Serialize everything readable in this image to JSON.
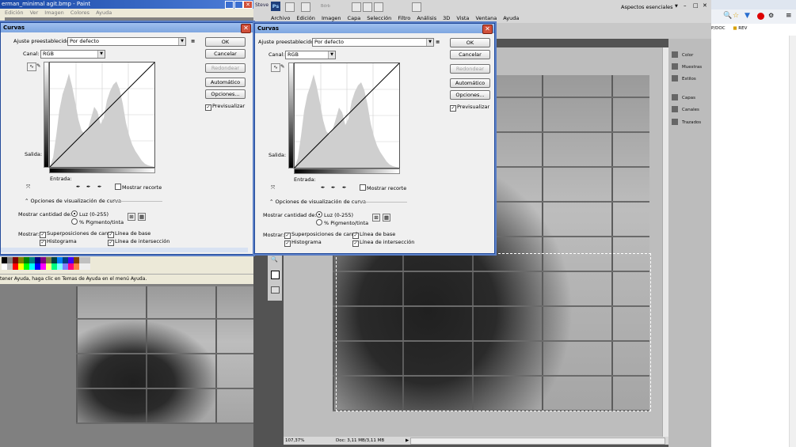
{
  "paint": {
    "title": "erman_minimal agit.bmp - Paint",
    "menu": [
      "Edición",
      "Ver",
      "Imagen",
      "Colores",
      "Ayuda"
    ],
    "status": "tener Ayuda, haga clic en Temas de Ayuda en el menú Ayuda."
  },
  "photoshop": {
    "tab": "Steve",
    "logo": "Ps",
    "tool_mini": "Bdrb",
    "menu": [
      "Archivo",
      "Edición",
      "Imagen",
      "Capa",
      "Selección",
      "Filtro",
      "Análisis",
      "3D",
      "Vista",
      "Ventana",
      "Ayuda"
    ],
    "workspace": "Aspectos esenciales",
    "zoom": "107,37%",
    "doc": "Doc: 3,11 MB/3,11 MB",
    "panels": [
      "Color",
      "Muestras",
      "Estilos",
      "Capas",
      "Canales",
      "Trazados"
    ]
  },
  "browser": {
    "bookmark1": "P/DOC",
    "bookmark2": "REV"
  },
  "curves": {
    "title": "Curvas",
    "preset_label": "Ajuste preestablecido:",
    "preset_value": "Por defecto",
    "channel_label": "Canal:",
    "channel_value": "RGB",
    "output_label": "Salida:",
    "input_label": "Entrada:",
    "show_clip": "Mostrar recorte",
    "display_options": "Opciones de visualización de curva",
    "show_amount": "Mostrar cantidad de:",
    "light": "Luz (0-255)",
    "pigment": "% Pigmento/tinta",
    "show": "Mostrar:",
    "overlays": "Superposiciones de canal",
    "baseline": "Línea de base",
    "histogram": "Histograma",
    "intersection": "Línea de intersección",
    "buttons": {
      "ok": "OK",
      "cancel": "Cancelar",
      "smooth": "Redondear",
      "auto": "Automático",
      "options": "Opciones...",
      "preview": "Previsualizar"
    }
  },
  "colors": {
    "title_active": "#7ea6e0",
    "title_paint": "#2a5dbf",
    "ps_bg": "#535353"
  }
}
